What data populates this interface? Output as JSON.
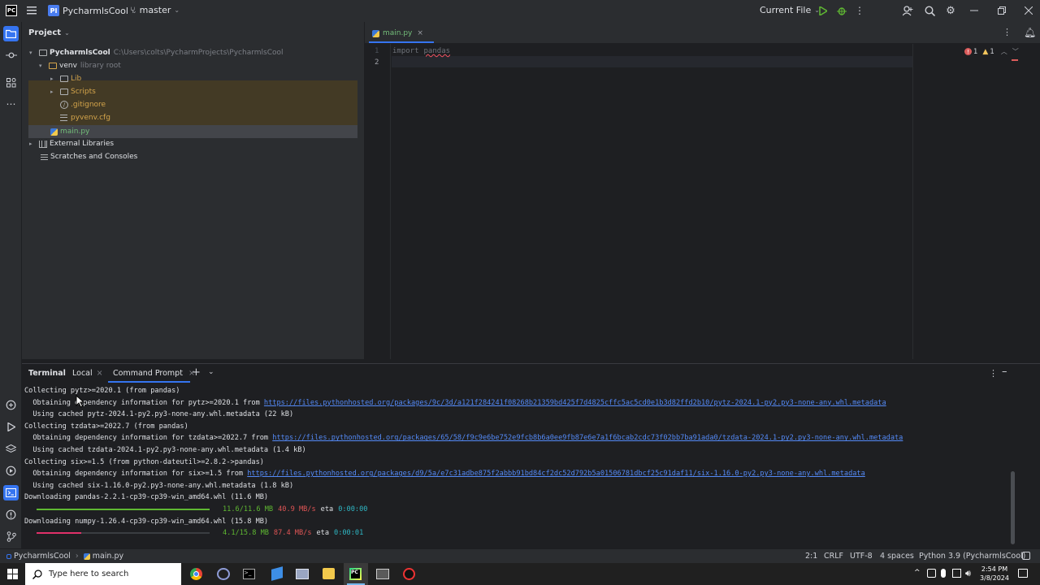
{
  "titlebar": {
    "project_badge": "PI",
    "project_name": "PycharmlsCool",
    "branch": "master",
    "run_config": "Current File"
  },
  "project_panel": {
    "title": "Project",
    "root": {
      "name": "PycharmlsCool",
      "path": "C:\\Users\\colts\\PycharmProjects\\PycharmlsCool"
    },
    "venv": {
      "name": "venv",
      "hint": "library root"
    },
    "items": {
      "lib": "Lib",
      "scripts": "Scripts",
      "gitignore": ".gitignore",
      "pyvenv": "pyvenv.cfg",
      "main": "main.py",
      "external": "External Libraries",
      "scratches": "Scratches and Consoles"
    }
  },
  "editor": {
    "tab": "main.py",
    "lines": [
      "1",
      "2"
    ],
    "code_keyword": "import",
    "code_module": "pandas",
    "errors": "1",
    "warnings": "1"
  },
  "terminal": {
    "tabs": {
      "terminal": "Terminal",
      "local": "Local",
      "cmd": "Command Prompt"
    },
    "lines": [
      {
        "text": "Collecting pytz>=2020.1 (from pandas)"
      },
      {
        "text": "  Obtaining dependency information for pytz>=2020.1 from ",
        "link": "https://files.pythonhosted.org/packages/9c/3d/a121f284241f08268b21359bd425f7d4825cffc5ac5cd0e1b3d82ffd2b10/pytz-2024.1-py2.py3-none-any.whl.metadata"
      },
      {
        "text": "  Using cached pytz-2024.1-py2.py3-none-any.whl.metadata (22 kB)"
      },
      {
        "text": "Collecting tzdata>=2022.7 (from pandas)"
      },
      {
        "text": "  Obtaining dependency information for tzdata>=2022.7 from ",
        "link": "https://files.pythonhosted.org/packages/65/58/f9c9e6be752e9fcb8b6a0ee9fb87e6e7a1f6bcab2cdc73f02bb7ba91ada0/tzdata-2024.1-py2.py3-none-any.whl.metadata"
      },
      {
        "text": "  Using cached tzdata-2024.1-py2.py3-none-any.whl.metadata (1.4 kB)"
      },
      {
        "text": "Collecting six>=1.5 (from python-dateutil>=2.8.2->pandas)"
      },
      {
        "text": "  Obtaining dependency information for six>=1.5 from ",
        "link": "https://files.pythonhosted.org/packages/d9/5a/e7c31adbe875f2abbb91bd84cf2dc52d792b5a01506781dbcf25c91daf11/six-1.16.0-py2.py3-none-any.whl.metadata"
      },
      {
        "text": "  Using cached six-1.16.0-py2.py3-none-any.whl.metadata (1.8 kB)"
      },
      {
        "text": "Downloading pandas-2.2.1-cp39-cp39-win_amd64.whl (11.6 MB)"
      },
      {
        "progress": 1.0,
        "size": "11.6/11.6 MB",
        "speed": "40.9 MB/s",
        "eta_label": "eta",
        "eta": "0:00:00",
        "color": "#5fb832"
      },
      {
        "text": "Downloading numpy-1.26.4-cp39-cp39-win_amd64.whl (15.8 MB)"
      },
      {
        "progress": 0.26,
        "size": "4.1/15.8 MB",
        "speed": "87.4 MB/s",
        "eta_label": "eta",
        "eta": "0:00:01",
        "color": "#e0306a"
      }
    ]
  },
  "statusbar": {
    "breadcrumb_project": "PycharmlsCool",
    "breadcrumb_file": "main.py",
    "position": "2:1",
    "line_sep": "CRLF",
    "encoding": "UTF-8",
    "indent": "4 spaces",
    "interpreter": "Python 3.9 (PycharmlsCool)"
  },
  "taskbar": {
    "search_placeholder": "Type here to search",
    "time": "2:54 PM",
    "date": "3/8/2024"
  },
  "colors": {
    "accent": "#3574f0",
    "selection": "#43454a",
    "venv_bg": "#433a25"
  }
}
